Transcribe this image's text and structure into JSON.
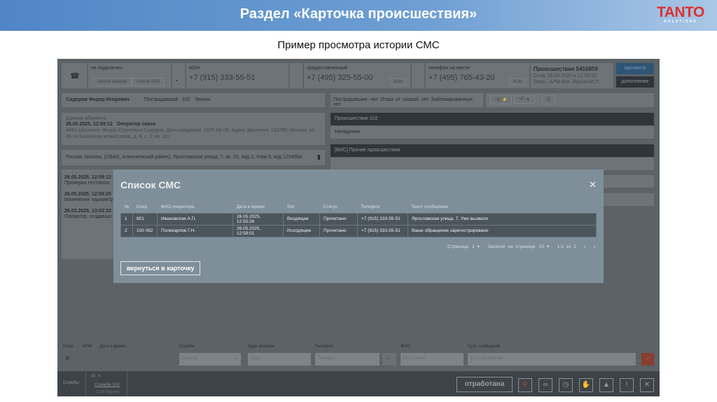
{
  "slide": {
    "title": "Раздел «Карточка происшествия»",
    "logo": "TANTO",
    "logo_sub": "SOLUTIONS",
    "subtitle": "Пример просмотра истории СМС"
  },
  "top": {
    "status": "не подключен",
    "btn_calls": "записи звонков",
    "btn_sms": "список SMS",
    "aon_label": "АОН",
    "aon_phone": "+7 (915) 333-55-51",
    "provided_label": "предоставленный",
    "provided_phone": "+7 (495) 325-55-00",
    "aon_btn": "АОН",
    "onsite_label": "телефон на месте",
    "onsite_phone": "+7 (495) 765-43-20",
    "aon_btn2": "АОН",
    "incident_title": "Происшествие 5416859",
    "incident_created": "Созд. 26.05.2025 в 12:58:10",
    "incident_operator": "Опер., АРМ 426, Якутин М.П.",
    "view_btn": "просмотр",
    "extra_btn": "дополнение"
  },
  "caller": {
    "name": "Сидоров Федор Игоревич",
    "role": "Пострадавший",
    "service": "102",
    "type": "Звонок"
  },
  "flags": {
    "victims": "Пострадавшие: нет",
    "refusal": "Отказ от скорой: нет",
    "blocked": "Заблокированные: нет",
    "cs": "ЧС",
    "cp": "ЧП"
  },
  "subscriber": {
    "label": "Данные абонента",
    "datetime": "26.05.2025, 12:59:12",
    "source": "Оператор связи",
    "details": "ФИО абонента: Федор Сергеевич Сидоров, Дата рождения: 1975-03-06, Адрес абонента: 154789, Москва, ул. 26-ти Бакинских комиссаров, д. 6, с. 1, кв. 321"
  },
  "address": "Россия, Москва, (СВАО, Алексеевский район), Ярославская улица, 7, кв. 25, под 2, этаж 5, код 123456А",
  "history": [
    {
      "time": "26.05.2025, 12:59:12",
      "text": "Проверка тестового"
    },
    {
      "time": "26.05.2025, 12:59:25",
      "text": "Изменение параметр"
    },
    {
      "time": "26.03.2025, 13:03:33",
      "text": "Оператор, создавши"
    }
  ],
  "right": {
    "incident": "Происшествие 102",
    "incident_type": "Нападение",
    "eis": "[ВИС] Прочие происшествия"
  },
  "modal": {
    "title": "Список СМС",
    "columns": [
      "№",
      "Опер.",
      "ФИО оператора",
      "Дата и время",
      "Тип",
      "Статус",
      "Телефон",
      "Текст сообщения"
    ],
    "rows": [
      [
        "1",
        "601",
        "Ивановская А.П.",
        "26.05.2025, 12:55:26",
        "Входящее",
        "Прочитано",
        "+7 (915) 333-55-51",
        "Ярославская улица, 7. Уже вызвали"
      ],
      [
        "2",
        "100 082",
        "Поликарпов Г.Н.",
        "26.05.2025, 12:59:01",
        "Исходящее",
        "Прочитано",
        "+7 (915) 333-55-51",
        "Ваше обращение зарегистрировано"
      ]
    ],
    "page": "Страница: 1",
    "per_page": "Записей на странице: 10",
    "range": "1-2 из 2",
    "back_btn": "вернуться в карточку"
  },
  "form": {
    "col_oper": "Опер.",
    "col_arm": "АРМ",
    "col_dt": "Дата и время",
    "service_label": "Служба",
    "service_ph": "Служба",
    "to_label": "Куда звонили",
    "to_ph": "Куда",
    "phone_label": "Телефон",
    "phone_ph": "Телефон",
    "fio_label": "ФИО",
    "fio_ph": "Кто принял",
    "msg_label": "Суть сообщения",
    "msg_ph": "Суть сообщения"
  },
  "bottom": {
    "services_label": "Службы:",
    "service": "Служба 102",
    "service_sub": "13:58 Принято",
    "done_btn": "отработана"
  }
}
